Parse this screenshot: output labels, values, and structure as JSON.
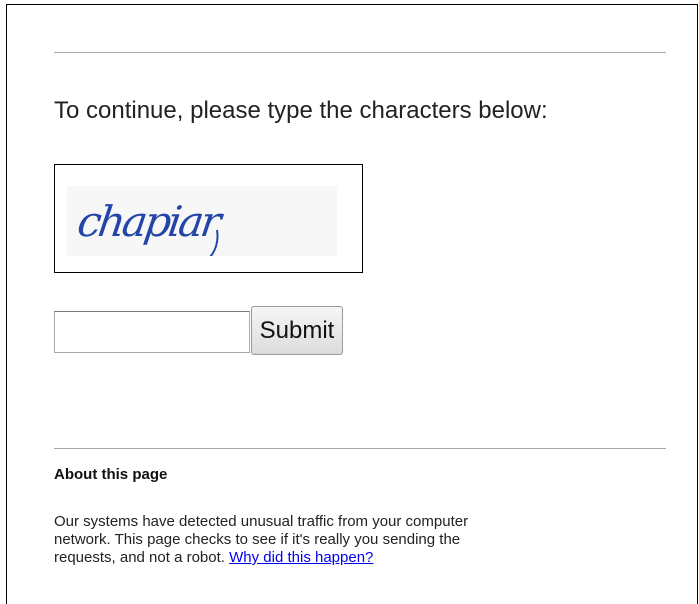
{
  "prompt": "To continue, please type the characters below:",
  "captcha": {
    "text": "chapiar",
    "ink_color": "#2345a8"
  },
  "form": {
    "input_value": "",
    "submit_label": "Submit"
  },
  "about": {
    "heading": "About this page",
    "lines": [
      "Our systems have detected unusual traffic from your computer",
      "network. This page checks to see if it's really you sending the",
      "requests, and not a robot."
    ],
    "link_text": "Why did this happen?"
  }
}
